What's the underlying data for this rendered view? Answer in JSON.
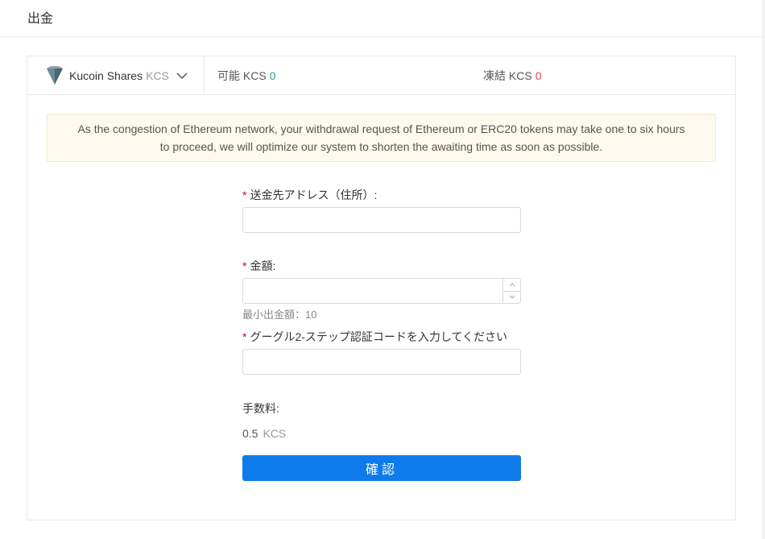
{
  "page": {
    "title": "出金"
  },
  "coin": {
    "name": "Kucoin Shares",
    "symbol": "KCS",
    "logo_icon": "kucoin-shares-diamond-icon"
  },
  "balances": {
    "available_label": "可能 KCS",
    "available_value": "0",
    "frozen_label": "凍結 KCS",
    "frozen_value": "0"
  },
  "notice": {
    "line1": "As the congestion of Ethereum network, your withdrawal request of Ethereum or ERC20 tokens may take one to six hours",
    "line2": "to proceed, we will optimize our system to shorten the awaiting time as soon as possible."
  },
  "form": {
    "required_mark": "*",
    "address_label": "送金先アドレス（住所）:",
    "address_value": "",
    "amount_label": "金額:",
    "amount_value": "",
    "min_amount_hint": "最小出金額：10",
    "twofa_label": "グーグル2-ステップ認証コードを入力してください",
    "twofa_value": "",
    "fee_label": "手数料:",
    "fee_amount": "0.5",
    "fee_unit": "KCS",
    "confirm_label": "確認"
  },
  "colors": {
    "accent": "#0f7bea",
    "available_value": "#26a69a",
    "frozen_value": "#f5424f",
    "required": "#d0021b",
    "notice_bg": "#fff8ec"
  }
}
